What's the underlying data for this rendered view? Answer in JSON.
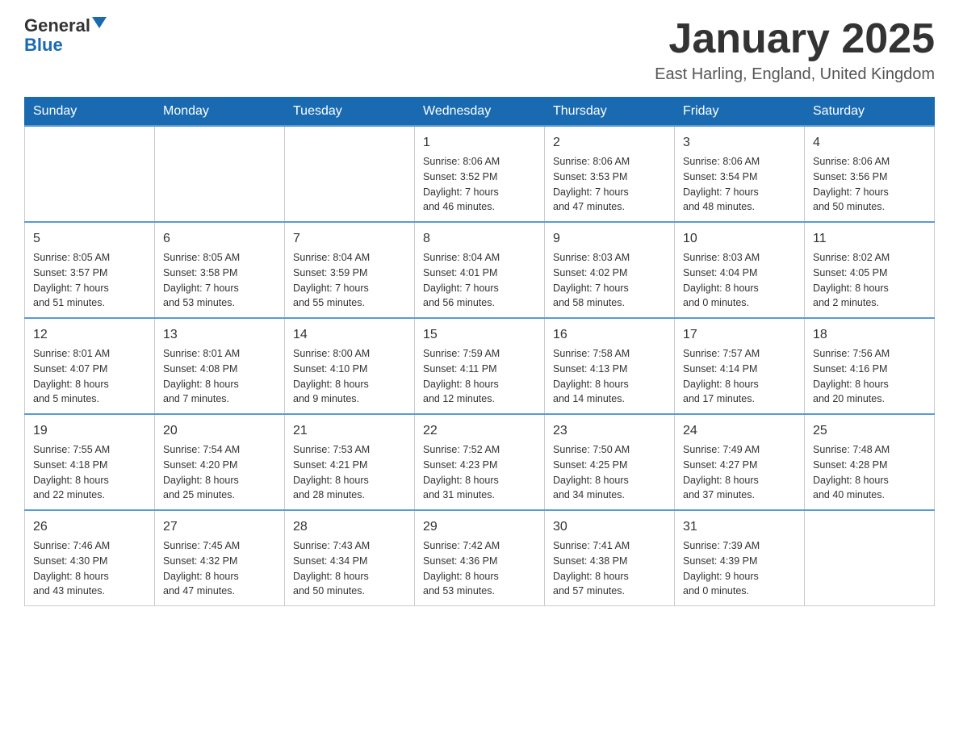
{
  "logo": {
    "text_general": "General",
    "text_blue": "Blue"
  },
  "title": "January 2025",
  "location": "East Harling, England, United Kingdom",
  "headers": [
    "Sunday",
    "Monday",
    "Tuesday",
    "Wednesday",
    "Thursday",
    "Friday",
    "Saturday"
  ],
  "weeks": [
    [
      {
        "day": "",
        "info": ""
      },
      {
        "day": "",
        "info": ""
      },
      {
        "day": "",
        "info": ""
      },
      {
        "day": "1",
        "info": "Sunrise: 8:06 AM\nSunset: 3:52 PM\nDaylight: 7 hours\nand 46 minutes."
      },
      {
        "day": "2",
        "info": "Sunrise: 8:06 AM\nSunset: 3:53 PM\nDaylight: 7 hours\nand 47 minutes."
      },
      {
        "day": "3",
        "info": "Sunrise: 8:06 AM\nSunset: 3:54 PM\nDaylight: 7 hours\nand 48 minutes."
      },
      {
        "day": "4",
        "info": "Sunrise: 8:06 AM\nSunset: 3:56 PM\nDaylight: 7 hours\nand 50 minutes."
      }
    ],
    [
      {
        "day": "5",
        "info": "Sunrise: 8:05 AM\nSunset: 3:57 PM\nDaylight: 7 hours\nand 51 minutes."
      },
      {
        "day": "6",
        "info": "Sunrise: 8:05 AM\nSunset: 3:58 PM\nDaylight: 7 hours\nand 53 minutes."
      },
      {
        "day": "7",
        "info": "Sunrise: 8:04 AM\nSunset: 3:59 PM\nDaylight: 7 hours\nand 55 minutes."
      },
      {
        "day": "8",
        "info": "Sunrise: 8:04 AM\nSunset: 4:01 PM\nDaylight: 7 hours\nand 56 minutes."
      },
      {
        "day": "9",
        "info": "Sunrise: 8:03 AM\nSunset: 4:02 PM\nDaylight: 7 hours\nand 58 minutes."
      },
      {
        "day": "10",
        "info": "Sunrise: 8:03 AM\nSunset: 4:04 PM\nDaylight: 8 hours\nand 0 minutes."
      },
      {
        "day": "11",
        "info": "Sunrise: 8:02 AM\nSunset: 4:05 PM\nDaylight: 8 hours\nand 2 minutes."
      }
    ],
    [
      {
        "day": "12",
        "info": "Sunrise: 8:01 AM\nSunset: 4:07 PM\nDaylight: 8 hours\nand 5 minutes."
      },
      {
        "day": "13",
        "info": "Sunrise: 8:01 AM\nSunset: 4:08 PM\nDaylight: 8 hours\nand 7 minutes."
      },
      {
        "day": "14",
        "info": "Sunrise: 8:00 AM\nSunset: 4:10 PM\nDaylight: 8 hours\nand 9 minutes."
      },
      {
        "day": "15",
        "info": "Sunrise: 7:59 AM\nSunset: 4:11 PM\nDaylight: 8 hours\nand 12 minutes."
      },
      {
        "day": "16",
        "info": "Sunrise: 7:58 AM\nSunset: 4:13 PM\nDaylight: 8 hours\nand 14 minutes."
      },
      {
        "day": "17",
        "info": "Sunrise: 7:57 AM\nSunset: 4:14 PM\nDaylight: 8 hours\nand 17 minutes."
      },
      {
        "day": "18",
        "info": "Sunrise: 7:56 AM\nSunset: 4:16 PM\nDaylight: 8 hours\nand 20 minutes."
      }
    ],
    [
      {
        "day": "19",
        "info": "Sunrise: 7:55 AM\nSunset: 4:18 PM\nDaylight: 8 hours\nand 22 minutes."
      },
      {
        "day": "20",
        "info": "Sunrise: 7:54 AM\nSunset: 4:20 PM\nDaylight: 8 hours\nand 25 minutes."
      },
      {
        "day": "21",
        "info": "Sunrise: 7:53 AM\nSunset: 4:21 PM\nDaylight: 8 hours\nand 28 minutes."
      },
      {
        "day": "22",
        "info": "Sunrise: 7:52 AM\nSunset: 4:23 PM\nDaylight: 8 hours\nand 31 minutes."
      },
      {
        "day": "23",
        "info": "Sunrise: 7:50 AM\nSunset: 4:25 PM\nDaylight: 8 hours\nand 34 minutes."
      },
      {
        "day": "24",
        "info": "Sunrise: 7:49 AM\nSunset: 4:27 PM\nDaylight: 8 hours\nand 37 minutes."
      },
      {
        "day": "25",
        "info": "Sunrise: 7:48 AM\nSunset: 4:28 PM\nDaylight: 8 hours\nand 40 minutes."
      }
    ],
    [
      {
        "day": "26",
        "info": "Sunrise: 7:46 AM\nSunset: 4:30 PM\nDaylight: 8 hours\nand 43 minutes."
      },
      {
        "day": "27",
        "info": "Sunrise: 7:45 AM\nSunset: 4:32 PM\nDaylight: 8 hours\nand 47 minutes."
      },
      {
        "day": "28",
        "info": "Sunrise: 7:43 AM\nSunset: 4:34 PM\nDaylight: 8 hours\nand 50 minutes."
      },
      {
        "day": "29",
        "info": "Sunrise: 7:42 AM\nSunset: 4:36 PM\nDaylight: 8 hours\nand 53 minutes."
      },
      {
        "day": "30",
        "info": "Sunrise: 7:41 AM\nSunset: 4:38 PM\nDaylight: 8 hours\nand 57 minutes."
      },
      {
        "day": "31",
        "info": "Sunrise: 7:39 AM\nSunset: 4:39 PM\nDaylight: 9 hours\nand 0 minutes."
      },
      {
        "day": "",
        "info": ""
      }
    ]
  ]
}
